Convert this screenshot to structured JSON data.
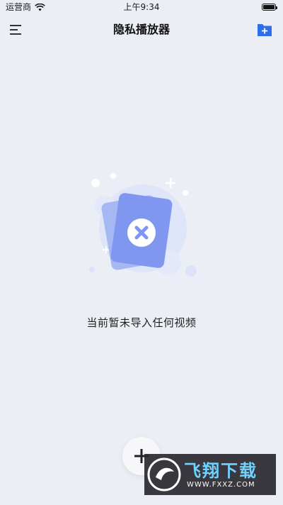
{
  "status_bar": {
    "carrier": "运营商",
    "time": "上午9:34",
    "wifi_icon": "wifi-icon",
    "battery_icon": "battery-icon"
  },
  "nav": {
    "title": "隐私播放器",
    "menu_icon": "menu-icon",
    "add_folder_icon": "folder-add-icon"
  },
  "empty_state": {
    "illustration_icon": "empty-video-cards-icon",
    "message": "当前暂未导入任何视频"
  },
  "fab": {
    "icon": "plus-icon"
  },
  "watermark": {
    "brand_text": "飞翔下载",
    "url": "WWW.FXXZ.COM"
  },
  "colors": {
    "background": "#eceef6",
    "accent_blue": "#2f6ee8",
    "card_blue": "#7f97ef"
  }
}
